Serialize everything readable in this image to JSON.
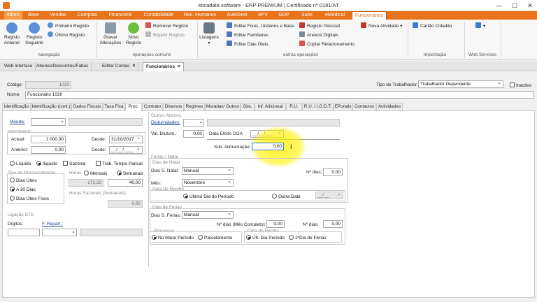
{
  "window": {
    "title": "eticadata software - ERP PREMIUM | Certificado nº 0181/AT",
    "min": "—",
    "max": "☐",
    "close": "✕"
  },
  "menu": [
    "Admin",
    "Base",
    "Vendas",
    "Compras",
    "Financeira",
    "Contabilidade",
    "Rec. Humanos",
    "AutoGest",
    "APV",
    "GOP",
    "Suite",
    "eMedical",
    "Funcionários"
  ],
  "ribbon": {
    "registo_anterior": "Registo\nAnterior",
    "registo_seguinte": "Registo\nSeguinte",
    "primeiro_registo": "Primeiro Registo",
    "ultimo_registo": "Último Registo",
    "group_navegacao": "navegação",
    "gravar": "Gravar\nAlterações",
    "novo": "Novo\nRegisto",
    "remover": "Remover Registo",
    "repetir": "Repetir Registo",
    "group_comuns": "operações comuns",
    "listagens": "Listagens",
    "editar_fixos": "Editar Fixos, Unitários e Base",
    "editar_familiares": "Editar Familiares",
    "editar_dias": "Editar Dias Úteis",
    "registo_pessoal": "Registo Pessoal",
    "anexos": "Anexos Digitais",
    "copiar": "Copiar Relacionamento",
    "nova_atividade": "Nova Atividade",
    "group_outras": "outras operações",
    "cartao": "Cartão Cidadão",
    "group_importacao": "Importação",
    "group_webservices": "Web Services"
  },
  "doc_tabs": [
    "Web Interface",
    "Abonos/Descontos/Faltas",
    "Editar Contas",
    "Funcionários"
  ],
  "header": {
    "codigo_label": "Código:",
    "codigo_value": "1020",
    "tipo_label": "Tipo de Trabalhador:",
    "tipo_value": "Trabalhador Dependente",
    "inactivo": "Inactivo",
    "nome_label": "Nome:",
    "nome_value": "Funcionário 1020"
  },
  "form_tabs": [
    "Identificação",
    "Identificação (cont.)",
    "Dados Fiscais",
    "Taxa Fixa",
    "Proc.",
    "Contrato",
    "Diversos",
    "Regimes",
    "Moradas/ Outros",
    "Obs.",
    "Inf. Adicional",
    "R.U.",
    "R.U. / I.G.D.T.",
    "EPortals",
    "Contactos",
    "Actividades"
  ],
  "left": {
    "moeda": "Moeda:",
    "vencimento": "Vencimento",
    "actual_label": "Actual:",
    "actual_value": "1 000,00",
    "desde_label": "Desde:",
    "desde1_value": "31/10/2017",
    "anterior_label": "Anterior:",
    "anterior_value": "0,00",
    "desde2_value": "__/__/____",
    "liquido": "Líquido",
    "iliquido": "Ilíquido",
    "sazonal": "Sazonal",
    "trab_parcial": "Trab. Tempo Parcial",
    "tipo_proc": "Tipo de Processamento",
    "dias_uteis": "Dias Úteis",
    "a30": "A 30 Dias",
    "dias_uteis_fixos": "Dias Úteis Fixos",
    "horas": "Horas",
    "mensais": "Mensais",
    "semanais": "Semanais",
    "mensais_value": "173,33",
    "semanais_value": "40,00",
    "horas_sazonais": "Horas Sazonais (Semanais)",
    "horas_sazonais_value": "0,00",
    "ligacao": "Ligação CTE",
    "digitos": "Dígitos:",
    "f_repart": "F. Repart.:"
  },
  "right": {
    "outros_abonos": "Outros Abonos",
    "diuturnidades": "Diuturnidades:",
    "val_diutum_label": "Val. Diutum.:",
    "val_diutum_value": "0,00",
    "data_efeito": "Data Efeito CGA",
    "data_efeito_value": "__/__/____",
    "sub_alim_label": "Sub. Alimentação:",
    "sub_alim_value": "0,00",
    "ferias_natal": "Férias / Natal",
    "dias_natal_group": "Dias de Natal",
    "dias_s_natal": "Dias S. Natal:",
    "dias_s_natal_value": "Manual",
    "n_dias_label": "Nº dias:",
    "n_dias_value": "0,00",
    "mes_label": "Mês:",
    "mes_value": "Novembro",
    "data_recibo": "Data do Recibo",
    "ultimo_dia": "Último Dia do Período",
    "outra_data": "Outra Data",
    "outra_data_value": "__/__",
    "dias_ferias_group": "Dias de Férias",
    "dias_s_ferias": "Dias S. Férias:",
    "dias_s_ferias_value": "Manual",
    "n_dias_mes": "Nº dias (Mês Completo):",
    "n_dias_mes_value": "0,00",
    "n_dias2_label": "Nº dias:",
    "n_dias2_value": "0,00",
    "processar": "Processar",
    "maior_periodo": "No Maior Período",
    "parcelamente": "Parcelamente",
    "data_recibo2": "Data do Recibo",
    "ult_dia": "Últ. Dia Período",
    "primeiro_dia": "1ºDia de Férias"
  }
}
